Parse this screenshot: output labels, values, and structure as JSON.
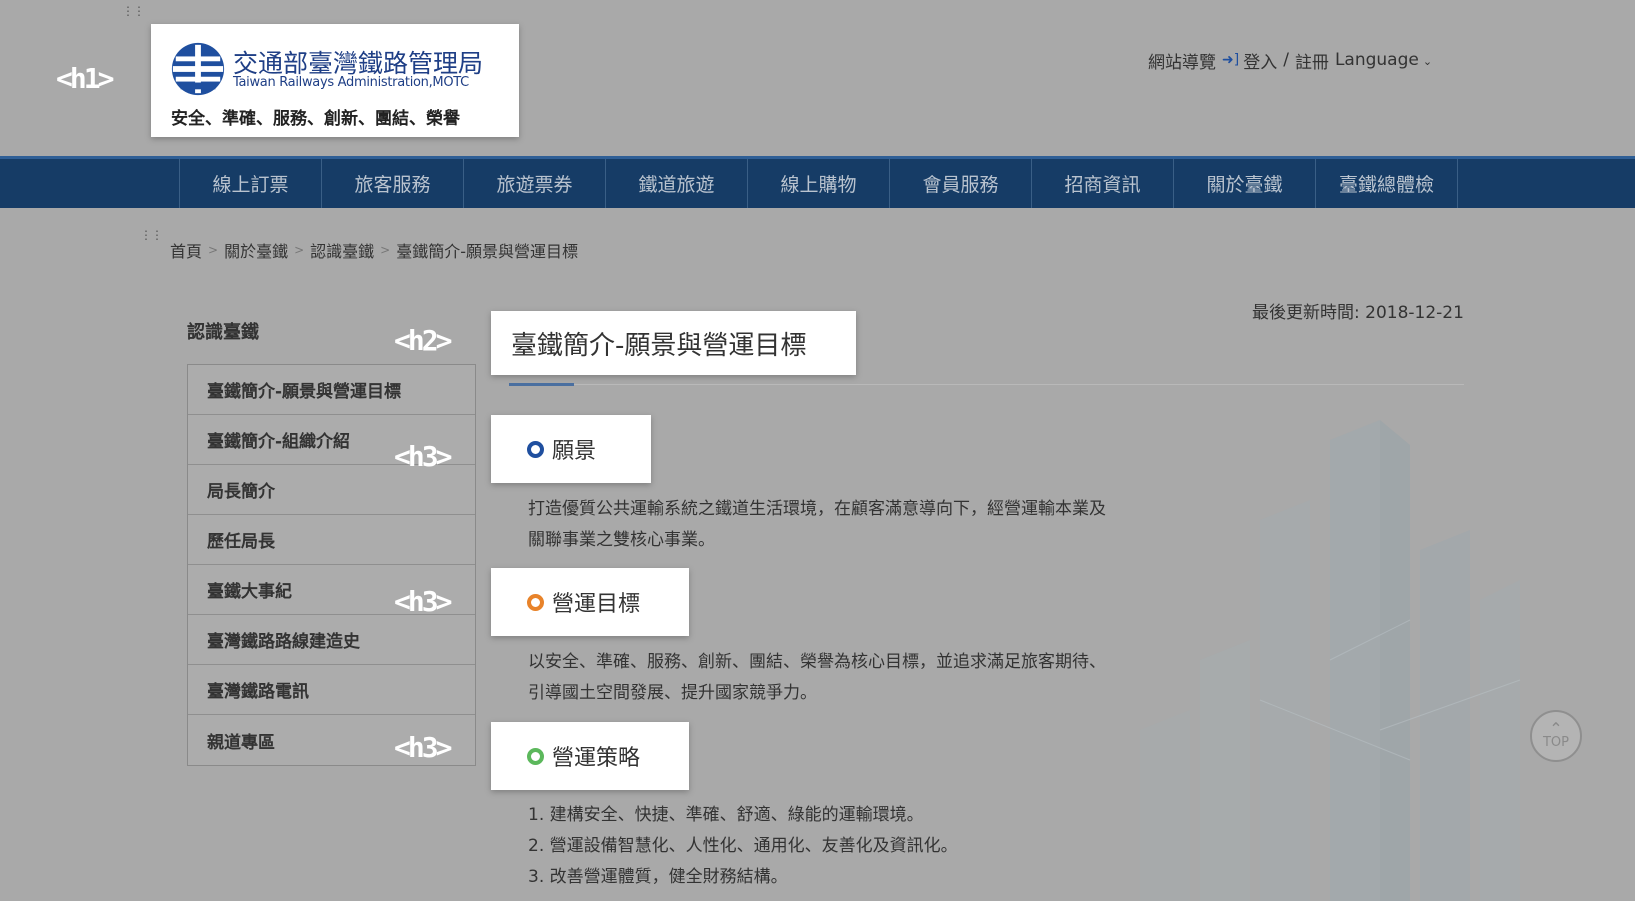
{
  "header": {
    "logo_name": "交通部臺灣鐵路管理局",
    "logo_english": "Taiwan Railways Administration,MOTC",
    "slogan": "安全、準確、服務、創新、團結、榮譽",
    "h1_tag": "<h1>",
    "top_links": {
      "sitemap": "網站導覽",
      "login": "登入",
      "separator": "/",
      "register": "註冊",
      "language": "Language"
    }
  },
  "nav": {
    "items": [
      "線上訂票",
      "旅客服務",
      "旅遊票券",
      "鐵道旅遊",
      "線上購物",
      "會員服務",
      "招商資訊",
      "關於臺鐵",
      "臺鐵總體檢"
    ]
  },
  "breadcrumb": {
    "items": [
      "首頁",
      "關於臺鐵",
      "認識臺鐵",
      "臺鐵簡介-願景與營運目標"
    ],
    "separator": ">"
  },
  "sidebar": {
    "title": "認識臺鐵",
    "items": [
      "臺鐵簡介-願景與營運目標",
      "臺鐵簡介-組織介紹",
      "局長簡介",
      "歷任局長",
      "臺鐵大事紀",
      "臺灣鐵路路線建造史",
      "臺灣鐵路電訊",
      "親道專區"
    ]
  },
  "content": {
    "last_updated": "最後更新時間: 2018-12-21",
    "h2_tag": "<h2>",
    "h3_tag": "<h3>",
    "title": "臺鐵簡介-願景與營運目標",
    "sections": [
      {
        "heading": "願景",
        "ring_color": "#1f4f9f",
        "lines": [
          "打造優質公共運輸系統之鐵道生活環境，在顧客滿意導向下，經營運輸本業及",
          "關聯事業之雙核心事業。"
        ]
      },
      {
        "heading": "營運目標",
        "ring_color": "#e8832a",
        "lines": [
          "以安全、準確、服務、創新、團結、榮譽為核心目標，並追求滿足旅客期待、",
          "引導國土空間發展、提升國家競爭力。"
        ]
      },
      {
        "heading": "營運策略",
        "ring_color": "#5cb85c",
        "lines": [
          "1. 建構安全、快捷、準確、舒適、綠能的運輸環境。",
          "2. 營運設備智慧化、人性化、通用化、友善化及資訊化。",
          "3. 改善營運體質，健全財務結構。"
        ]
      }
    ]
  },
  "top_button": {
    "label": "TOP"
  },
  "colors": {
    "nav_bg": "#163c66",
    "overlay_gray": "#a9a9a9",
    "brand_blue": "#1f4f9f"
  }
}
